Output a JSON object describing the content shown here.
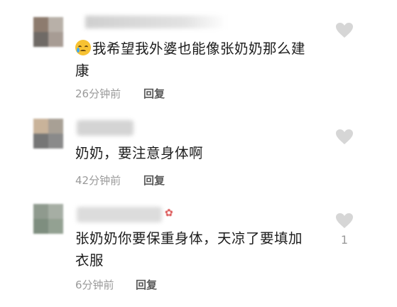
{
  "colors": {
    "text": "#1c1c1c",
    "meta": "#9a9a9a",
    "reply": "#5a5a5a",
    "heart": "#d6d6d6"
  },
  "comments": [
    {
      "avatar_colors": [
        "#8d7b6e",
        "#b8b0a8",
        "#6f6a66",
        "#a79c94"
      ],
      "emoji": "crying-face-emoji",
      "text_line1": "我希望我外婆也能像张奶奶那么建",
      "text_line2": "康",
      "time": "26分钟前",
      "reply_label": "回复",
      "like_count": ""
    },
    {
      "avatar_colors": [
        "#c9b39a",
        "#a8a095",
        "#767676",
        "#8a8a8a"
      ],
      "text_line1": "奶奶，要注意身体啊",
      "time": "42分钟前",
      "reply_label": "回复",
      "like_count": ""
    },
    {
      "avatar_colors": [
        "#8f9a8e",
        "#a6aea4",
        "#7e8e7f",
        "#93a192"
      ],
      "text_line1": "张奶奶你要保重身体，天凉了要填加",
      "text_line2": "衣服",
      "time": "6分钟前",
      "reply_label": "回复",
      "like_count": "1"
    }
  ]
}
